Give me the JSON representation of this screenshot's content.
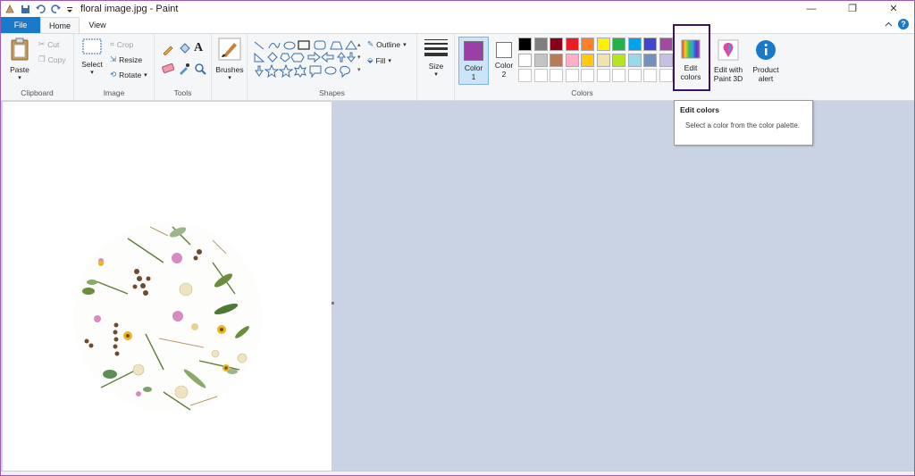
{
  "titlebar": {
    "title": "floral image.jpg - Paint",
    "minimize_glyph": "—",
    "restore_glyph": "❐",
    "close_glyph": "✕"
  },
  "tabs": {
    "file": "File",
    "home": "Home",
    "view": "View"
  },
  "clipboard": {
    "paste": "Paste",
    "cut": "Cut",
    "copy": "Copy",
    "group": "Clipboard"
  },
  "image": {
    "select": "Select",
    "crop": "Crop",
    "resize": "Resize",
    "rotate": "Rotate",
    "group": "Image"
  },
  "tools": {
    "group": "Tools",
    "text_glyph": "A"
  },
  "brushes": {
    "label": "Brushes"
  },
  "shapes": {
    "outline": "Outline",
    "fill": "Fill",
    "group": "Shapes"
  },
  "size": {
    "label": "Size"
  },
  "colors": {
    "color1": "Color 1",
    "color2": "Color 2",
    "color1_value": "#9b3fa6",
    "color2_value": "#ffffff",
    "group": "Colors",
    "row1": [
      "#000000",
      "#7f7f7f",
      "#880015",
      "#ed1c24",
      "#ff7f27",
      "#fff200",
      "#22b14c",
      "#00a2e8",
      "#3f48cc",
      "#a349a4"
    ],
    "row2": [
      "#ffffff",
      "#c3c3c3",
      "#b97a57",
      "#ffaec9",
      "#ffc90e",
      "#efe4b0",
      "#b5e61d",
      "#99d9ea",
      "#7092be",
      "#c8bfe7"
    ]
  },
  "edit_colors": {
    "label": "Edit colors"
  },
  "paint3d": {
    "label": "Edit with Paint 3D"
  },
  "product_alert": {
    "label": "Product alert"
  },
  "tooltip": {
    "title": "Edit colors",
    "body": "Select a color from the color palette."
  }
}
